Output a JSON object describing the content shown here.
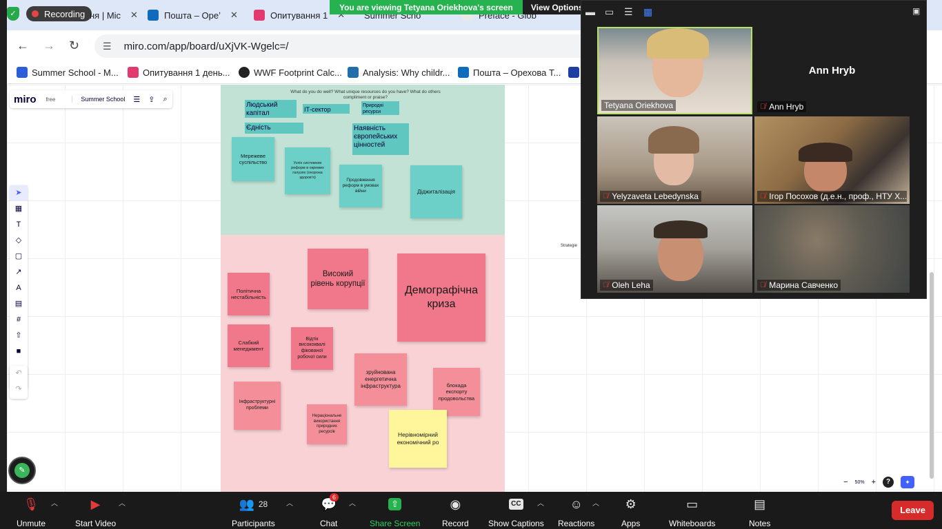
{
  "browser": {
    "recording_label": "Recording",
    "tabs": [
      {
        "label": "ня | Mic",
        "color": "#2b5fd9"
      },
      {
        "label": "Пошта – Ореʼ",
        "color": "#0f6cbd"
      },
      {
        "label": "Опитування 1",
        "color": "#e23a6e"
      },
      {
        "label": "Summer Scho",
        "color": "#ffd02f"
      },
      {
        "label": "Preface - Glob",
        "color": "#e8e8e8"
      }
    ],
    "url": "miro.com/app/board/uXjVK-Wgelc=/",
    "bookmarks": [
      {
        "label": "Summer School - M...",
        "color": "#2b5fd9"
      },
      {
        "label": "Опитування 1 день...",
        "color": "#e23a6e"
      },
      {
        "label": "WWF Footprint Calc...",
        "color": "#222222"
      },
      {
        "label": "Analysis: Why childr...",
        "color": "#1f6fa8"
      },
      {
        "label": "Пошта – Орехова Т...",
        "color": "#0f6cbd"
      }
    ]
  },
  "banner": {
    "message": "You are viewing Tetyana Oriekhova's screen",
    "options": "View Options"
  },
  "miro": {
    "logo": "miro",
    "plan": "free",
    "board_name": "Summer School",
    "zoom_level": "50%",
    "help": "?",
    "green_caption": "What do you do well? What unique resources do you have? What do others compliment or praise?",
    "side_caption": "Strategie",
    "text_labels": [
      "Людський капітал",
      "ІТ-сектор",
      "Природні ресурси",
      "Єдність",
      "Наявність європейських цінностей"
    ],
    "teal_notes": [
      "Мережеве суспільство",
      "Успіх системних реформ в окремих галузях (охорона здоровʼя)",
      "Продовження реформ в умовах війни",
      "Діджиталізація"
    ],
    "pink_notes": [
      "Високий рівень корупції",
      "Демографічна криза",
      "Політична нестабільність",
      "Слабкий менеджмент",
      "Відтік висококвалі фікованої робочої сили",
      "зруйнована енергетична інфраструктура",
      "блокада експорту продовольства",
      "Інфраструктурні проблеми",
      "Нераціональне використання природних ресурсів"
    ],
    "yellow_note": "Нерівномірний економічний ро"
  },
  "video": {
    "participants": [
      {
        "name": "Tetyana Oriekhova",
        "muted": false,
        "active": true
      },
      {
        "name": "Ann Hryb",
        "muted": true,
        "active": false,
        "video_off": true
      },
      {
        "name": "Yelyzaveta Lebedynska",
        "muted": true,
        "active": false
      },
      {
        "name": "Ігор Посохов (д.е.н., проф., НТУ Х...",
        "muted": true,
        "active": false
      },
      {
        "name": "Oleh Leha",
        "muted": true,
        "active": false
      },
      {
        "name": "Марина Савченко",
        "muted": true,
        "active": false
      }
    ]
  },
  "zoombar": {
    "unmute": "Unmute",
    "start_video": "Start Video",
    "participants": "Participants",
    "participants_count": "28",
    "chat": "Chat",
    "chat_badge": "6",
    "share_screen": "Share Screen",
    "record": "Record",
    "show_captions": "Show Captions",
    "reactions": "Reactions",
    "apps": "Apps",
    "whiteboards": "Whiteboards",
    "notes": "Notes",
    "leave": "Leave",
    "captions_icon": "CC"
  }
}
